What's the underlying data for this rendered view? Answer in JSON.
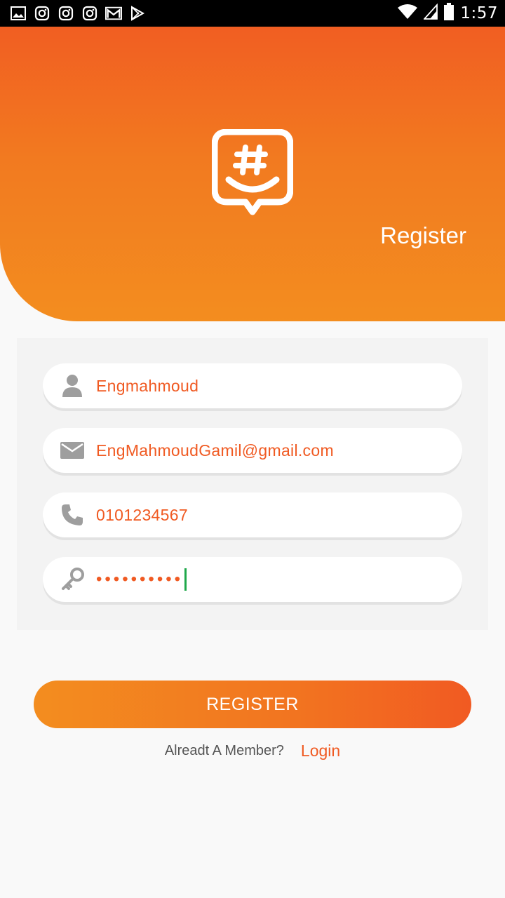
{
  "status_bar": {
    "time": "1:57",
    "left_icons": [
      "image-icon",
      "instagram-icon",
      "instagram-icon",
      "instagram-icon",
      "gmail-icon",
      "play-store-icon"
    ],
    "right_icons": [
      "wifi-icon",
      "signal-icon",
      "battery-icon"
    ]
  },
  "header": {
    "title": "Register",
    "logo_icon": "chat-hashtag-smile-logo",
    "gradient": [
      "#f15e22",
      "#f38d1f"
    ]
  },
  "form": {
    "username": {
      "value": "Engmahmoud",
      "icon": "user-icon"
    },
    "email": {
      "value": "EngMahmoudGamil@gmail.com",
      "icon": "email-icon"
    },
    "phone": {
      "value": "0101234567",
      "icon": "phone-icon"
    },
    "password": {
      "masked": "••••••••••",
      "icon": "key-icon"
    }
  },
  "register_button": {
    "label": "REGISTER"
  },
  "footer": {
    "question": "Alreadt A Member?",
    "login_label": "Login"
  },
  "colors": {
    "accent": "#f05a22",
    "icon_gray": "#9e9e9e",
    "caret": "#1fa84a"
  }
}
